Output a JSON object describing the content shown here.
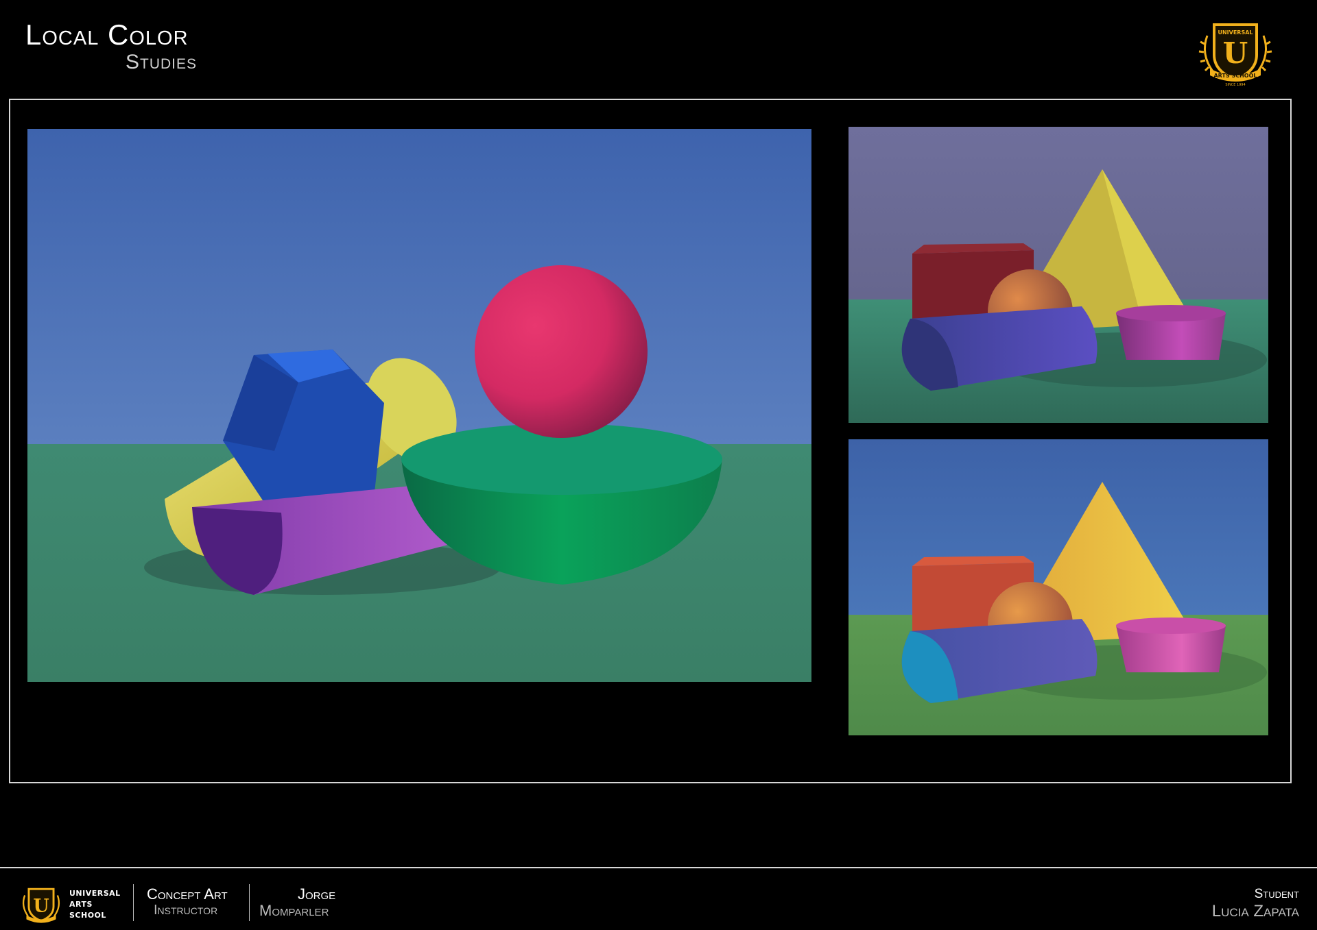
{
  "header": {
    "title": "Local Color",
    "subtitle": "Studies"
  },
  "logo": {
    "top_line": "UNIVERSAL",
    "letter": "U",
    "banner": "ARTS SCHOOL",
    "since": "SINCE 1994"
  },
  "footer": {
    "school_lines": [
      "UNIVERSAL",
      "ARTS",
      "SCHOOL"
    ],
    "course": "Concept Art",
    "instructor_label": "Instructor",
    "instructor_first": "Jorge",
    "instructor_last": "Momparler",
    "student_label": "Student",
    "student_name": "Lucia Zapata"
  },
  "colors": {
    "background": "#000000",
    "frame": "#d8d8d8",
    "logo_gold": "#f2b11c",
    "sky_main": "#4a6fb0",
    "ground_main": "#3f8b70"
  }
}
